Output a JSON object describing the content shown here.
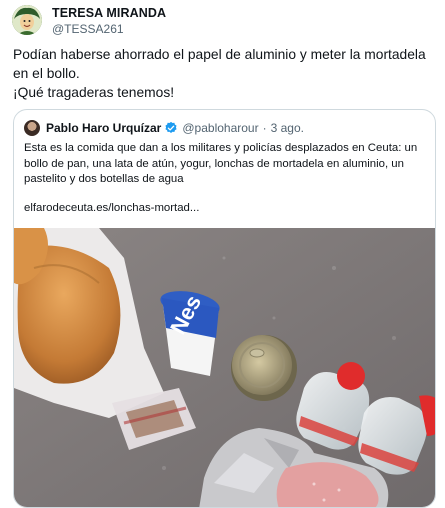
{
  "author": {
    "name": "TERESA MIRANDA",
    "handle": "@TESSA261",
    "avatar_icon": "avatar-cartoon"
  },
  "tweet": {
    "line1": "Podían haberse ahorrado el papel de aluminio y meter la mortadela en el bollo.",
    "line2": "¡Qué tragaderas tenemos!"
  },
  "quote": {
    "name": "Pablo Haro Urquízar",
    "verified_icon": "verified-badge-icon",
    "handle": "@pabloharour",
    "separator": "·",
    "time": "3 ago.",
    "text": "Esta es la comida que dan a los militares y policías desplazados en Ceuta: un bollo de pan, una lata de atún, yogur, lonchas de mortadela en aluminio, un pastelito y dos botellas de agua",
    "link": "elfarodeceuta.es/lonchas-mortad...",
    "yogurt_brand": "Nes"
  },
  "colors": {
    "text": "#0f1419",
    "secondary": "#536471",
    "border": "#cfd9de",
    "verified": "#1d9bf0"
  }
}
